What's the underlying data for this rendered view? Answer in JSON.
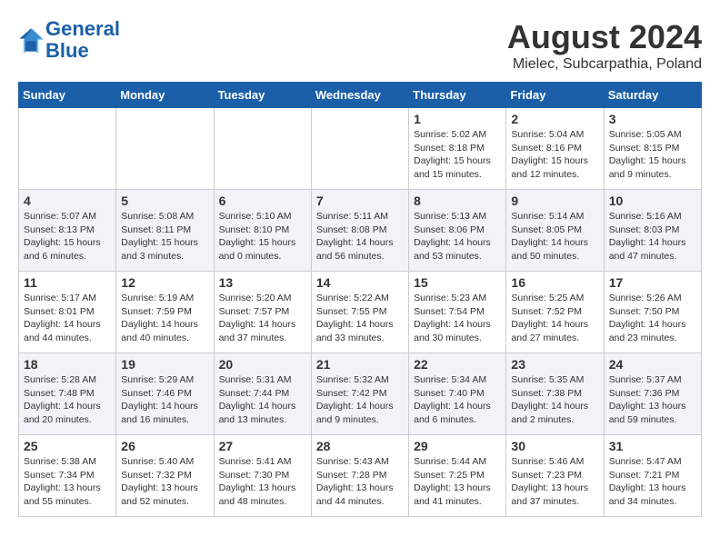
{
  "header": {
    "logo_line1": "General",
    "logo_line2": "Blue",
    "main_title": "August 2024",
    "subtitle": "Mielec, Subcarpathia, Poland"
  },
  "days_of_week": [
    "Sunday",
    "Monday",
    "Tuesday",
    "Wednesday",
    "Thursday",
    "Friday",
    "Saturday"
  ],
  "weeks": [
    {
      "cells": [
        {
          "day": null,
          "info": null
        },
        {
          "day": null,
          "info": null
        },
        {
          "day": null,
          "info": null
        },
        {
          "day": null,
          "info": null
        },
        {
          "day": "1",
          "info": "Sunrise: 5:02 AM\nSunset: 8:18 PM\nDaylight: 15 hours\nand 15 minutes."
        },
        {
          "day": "2",
          "info": "Sunrise: 5:04 AM\nSunset: 8:16 PM\nDaylight: 15 hours\nand 12 minutes."
        },
        {
          "day": "3",
          "info": "Sunrise: 5:05 AM\nSunset: 8:15 PM\nDaylight: 15 hours\nand 9 minutes."
        }
      ]
    },
    {
      "cells": [
        {
          "day": "4",
          "info": "Sunrise: 5:07 AM\nSunset: 8:13 PM\nDaylight: 15 hours\nand 6 minutes."
        },
        {
          "day": "5",
          "info": "Sunrise: 5:08 AM\nSunset: 8:11 PM\nDaylight: 15 hours\nand 3 minutes."
        },
        {
          "day": "6",
          "info": "Sunrise: 5:10 AM\nSunset: 8:10 PM\nDaylight: 15 hours\nand 0 minutes."
        },
        {
          "day": "7",
          "info": "Sunrise: 5:11 AM\nSunset: 8:08 PM\nDaylight: 14 hours\nand 56 minutes."
        },
        {
          "day": "8",
          "info": "Sunrise: 5:13 AM\nSunset: 8:06 PM\nDaylight: 14 hours\nand 53 minutes."
        },
        {
          "day": "9",
          "info": "Sunrise: 5:14 AM\nSunset: 8:05 PM\nDaylight: 14 hours\nand 50 minutes."
        },
        {
          "day": "10",
          "info": "Sunrise: 5:16 AM\nSunset: 8:03 PM\nDaylight: 14 hours\nand 47 minutes."
        }
      ]
    },
    {
      "cells": [
        {
          "day": "11",
          "info": "Sunrise: 5:17 AM\nSunset: 8:01 PM\nDaylight: 14 hours\nand 44 minutes."
        },
        {
          "day": "12",
          "info": "Sunrise: 5:19 AM\nSunset: 7:59 PM\nDaylight: 14 hours\nand 40 minutes."
        },
        {
          "day": "13",
          "info": "Sunrise: 5:20 AM\nSunset: 7:57 PM\nDaylight: 14 hours\nand 37 minutes."
        },
        {
          "day": "14",
          "info": "Sunrise: 5:22 AM\nSunset: 7:55 PM\nDaylight: 14 hours\nand 33 minutes."
        },
        {
          "day": "15",
          "info": "Sunrise: 5:23 AM\nSunset: 7:54 PM\nDaylight: 14 hours\nand 30 minutes."
        },
        {
          "day": "16",
          "info": "Sunrise: 5:25 AM\nSunset: 7:52 PM\nDaylight: 14 hours\nand 27 minutes."
        },
        {
          "day": "17",
          "info": "Sunrise: 5:26 AM\nSunset: 7:50 PM\nDaylight: 14 hours\nand 23 minutes."
        }
      ]
    },
    {
      "cells": [
        {
          "day": "18",
          "info": "Sunrise: 5:28 AM\nSunset: 7:48 PM\nDaylight: 14 hours\nand 20 minutes."
        },
        {
          "day": "19",
          "info": "Sunrise: 5:29 AM\nSunset: 7:46 PM\nDaylight: 14 hours\nand 16 minutes."
        },
        {
          "day": "20",
          "info": "Sunrise: 5:31 AM\nSunset: 7:44 PM\nDaylight: 14 hours\nand 13 minutes."
        },
        {
          "day": "21",
          "info": "Sunrise: 5:32 AM\nSunset: 7:42 PM\nDaylight: 14 hours\nand 9 minutes."
        },
        {
          "day": "22",
          "info": "Sunrise: 5:34 AM\nSunset: 7:40 PM\nDaylight: 14 hours\nand 6 minutes."
        },
        {
          "day": "23",
          "info": "Sunrise: 5:35 AM\nSunset: 7:38 PM\nDaylight: 14 hours\nand 2 minutes."
        },
        {
          "day": "24",
          "info": "Sunrise: 5:37 AM\nSunset: 7:36 PM\nDaylight: 13 hours\nand 59 minutes."
        }
      ]
    },
    {
      "cells": [
        {
          "day": "25",
          "info": "Sunrise: 5:38 AM\nSunset: 7:34 PM\nDaylight: 13 hours\nand 55 minutes."
        },
        {
          "day": "26",
          "info": "Sunrise: 5:40 AM\nSunset: 7:32 PM\nDaylight: 13 hours\nand 52 minutes."
        },
        {
          "day": "27",
          "info": "Sunrise: 5:41 AM\nSunset: 7:30 PM\nDaylight: 13 hours\nand 48 minutes."
        },
        {
          "day": "28",
          "info": "Sunrise: 5:43 AM\nSunset: 7:28 PM\nDaylight: 13 hours\nand 44 minutes."
        },
        {
          "day": "29",
          "info": "Sunrise: 5:44 AM\nSunset: 7:25 PM\nDaylight: 13 hours\nand 41 minutes."
        },
        {
          "day": "30",
          "info": "Sunrise: 5:46 AM\nSunset: 7:23 PM\nDaylight: 13 hours\nand 37 minutes."
        },
        {
          "day": "31",
          "info": "Sunrise: 5:47 AM\nSunset: 7:21 PM\nDaylight: 13 hours\nand 34 minutes."
        }
      ]
    }
  ]
}
